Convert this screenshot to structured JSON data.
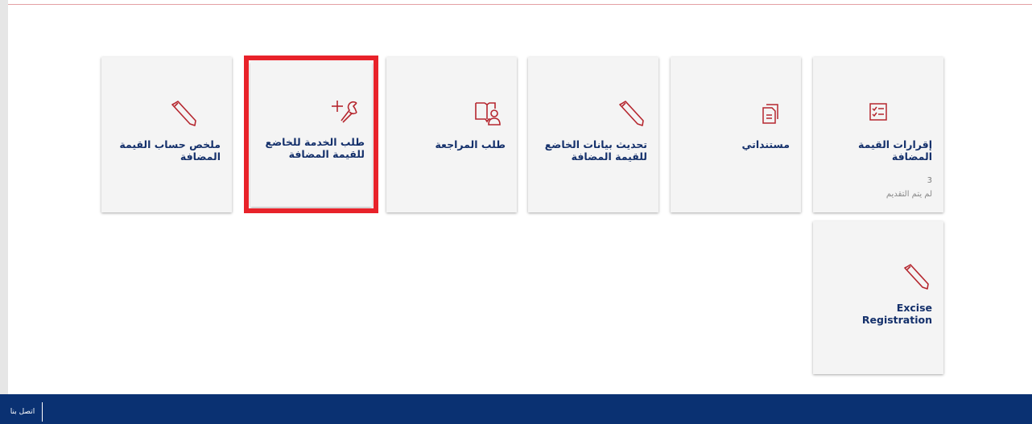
{
  "tiles": [
    {
      "title": "إقرارات القيمة المضافة",
      "count": "3",
      "status": "لم يتم التقديم",
      "icon": "checklist-icon"
    },
    {
      "title": "مستنداتي",
      "icon": "document-icon"
    },
    {
      "title": "تحديث بيانات الخاضع للقيمة المضافة",
      "icon": "pencil-icon"
    },
    {
      "title": "طلب المراجعة",
      "icon": "book-person-icon"
    },
    {
      "title": "طلب الخدمة للخاضع للقيمة المضافة",
      "icon": "wrench-plus-icon"
    },
    {
      "title": "ملخص حساب القيمة المضافة",
      "icon": "pencil-icon"
    },
    {
      "title": "Excise Registration",
      "icon": "pencil-icon"
    }
  ],
  "footer": {
    "contact_label": "اتصل بنا"
  },
  "colors": {
    "accent": "#b5262e",
    "title": "#14306b",
    "footer": "#0a3172",
    "selection": "#e8222a"
  }
}
